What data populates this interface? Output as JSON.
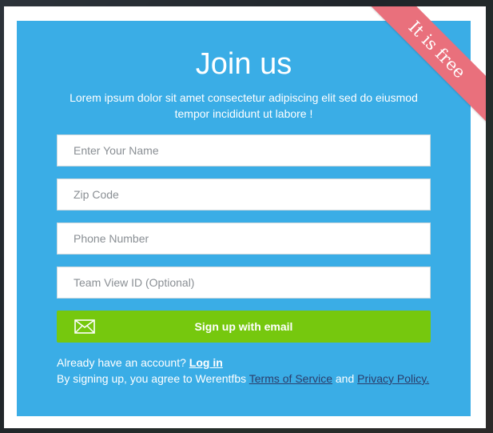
{
  "modal": {
    "ribbon_text": "It is free",
    "title": "Join us",
    "subtitle": "Lorem ipsum dolor sit amet consectetur adipiscing elit sed do eiusmod tempor incididunt ut labore !"
  },
  "form": {
    "name_placeholder": "Enter Your Name",
    "zip_placeholder": "Zip Code",
    "phone_placeholder": "Phone Number",
    "teamview_placeholder": "Team View ID (Optional)",
    "signup_label": "Sign up with email",
    "signup_icon": "mail-icon"
  },
  "footer": {
    "account_text": "Already have an account?",
    "login_label": "Log in",
    "agree_text": "By signing up, you agree to Werentfbs",
    "terms_label": "Terms of Service",
    "and_text": "and",
    "privacy_label": "Privacy Policy."
  },
  "colors": {
    "panel": "#3aade6",
    "ribbon": "#e9707c",
    "button": "#76c80e",
    "legal_link": "#2b3d6b"
  }
}
